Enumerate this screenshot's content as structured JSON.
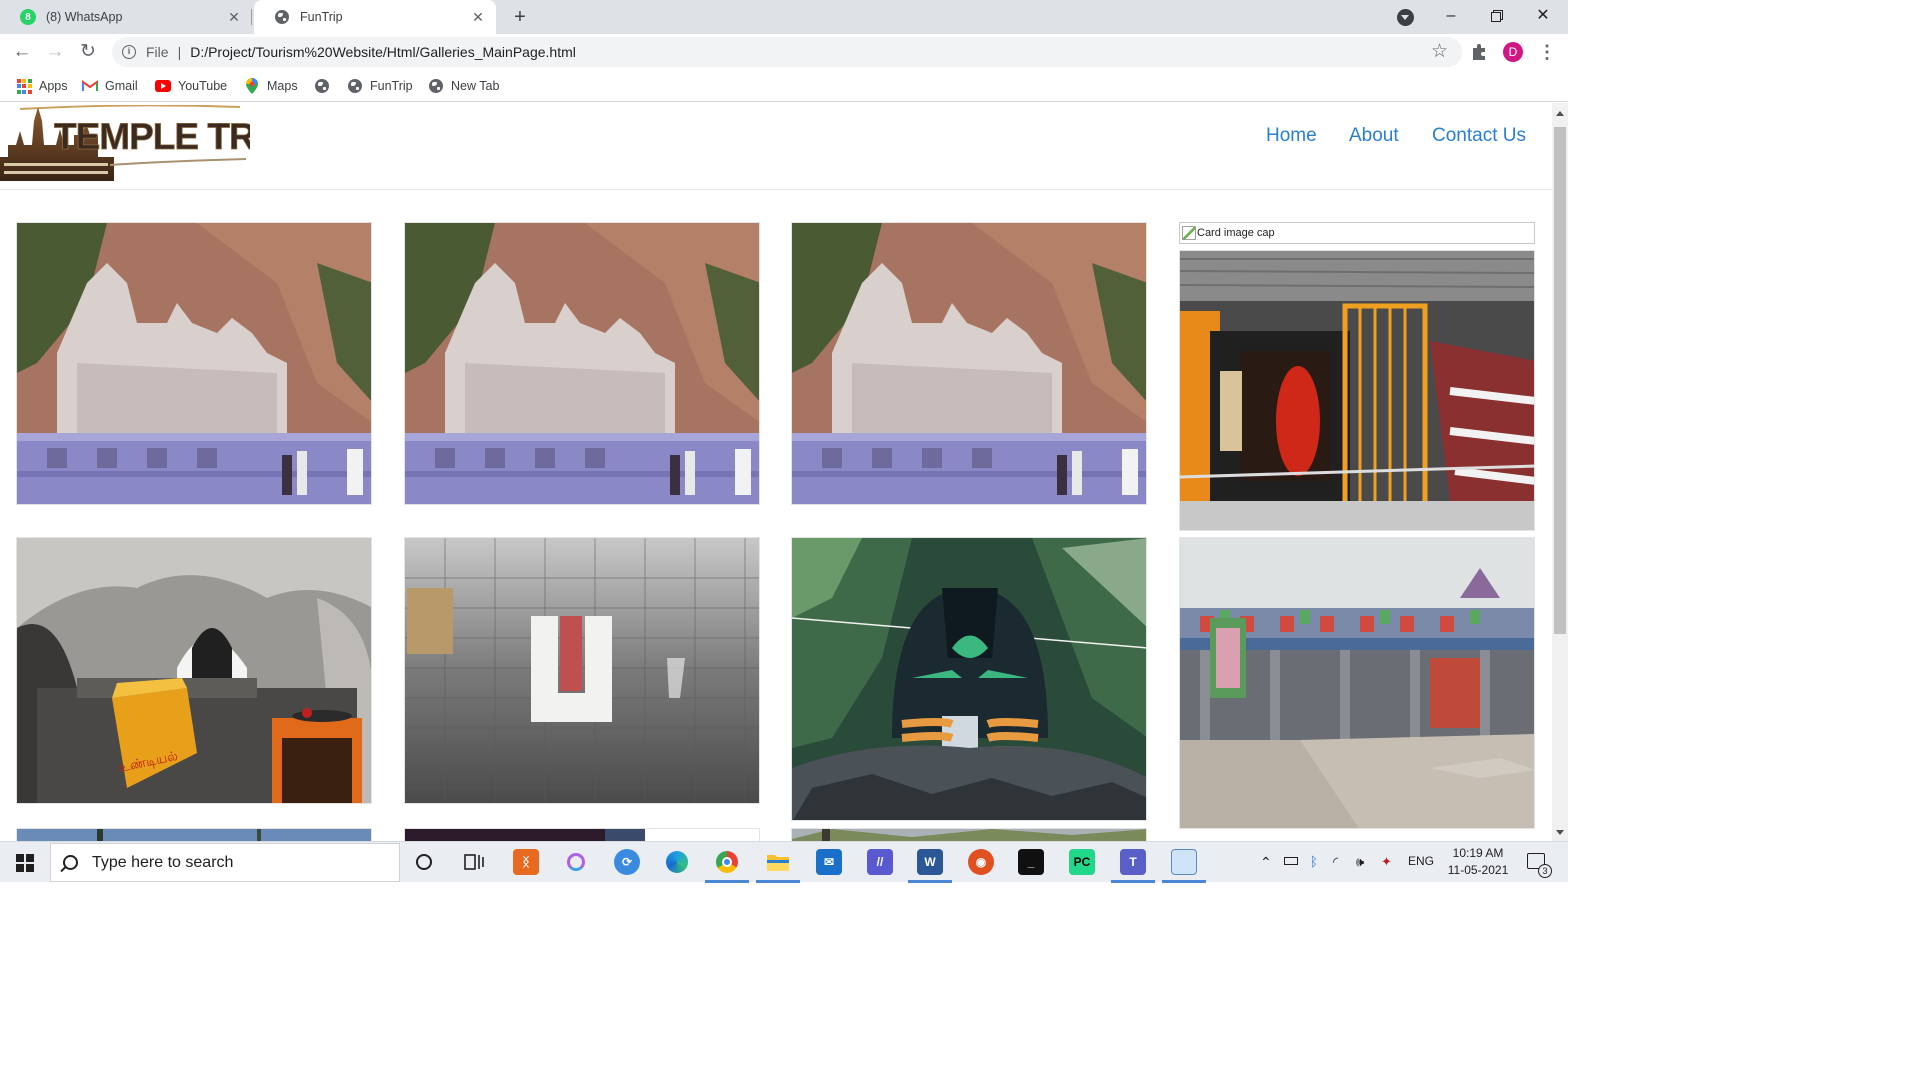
{
  "browser": {
    "tabs": [
      {
        "title": "(8) WhatsApp",
        "active": false,
        "badge": "8"
      },
      {
        "title": "FunTrip",
        "active": true
      }
    ],
    "address": {
      "scheme": "File",
      "url": "D:/Project/Tourism%20Website/Html/Galleries_MainPage.html"
    },
    "profile_initial": "D",
    "bookmarks": [
      {
        "label": "Apps",
        "icon": "apps-grid-icon"
      },
      {
        "label": "Gmail",
        "icon": "gmail-icon"
      },
      {
        "label": "YouTube",
        "icon": "youtube-icon"
      },
      {
        "label": "Maps",
        "icon": "maps-pin-icon"
      },
      {
        "label": "",
        "icon": "globe-icon"
      },
      {
        "label": "FunTrip",
        "icon": "globe-icon"
      },
      {
        "label": "New Tab",
        "icon": "globe-icon"
      }
    ]
  },
  "site": {
    "logo_text": "TEMPLE TRIP",
    "nav": [
      {
        "label": "Home"
      },
      {
        "label": "About"
      },
      {
        "label": "Contact Us"
      }
    ]
  },
  "gallery": {
    "broken_image_alt": "Card image cap",
    "photo_text": "உண்டியல்"
  },
  "taskbar": {
    "search_placeholder": "Type here to search",
    "language": "ENG",
    "time": "10:19 AM",
    "date": "11-05-2021",
    "notification_count": "3"
  }
}
